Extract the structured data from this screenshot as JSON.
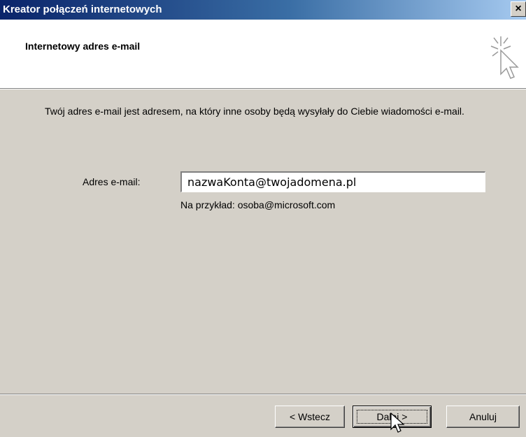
{
  "window": {
    "title": "Kreator połączeń internetowych",
    "close_label": "×"
  },
  "header": {
    "title": "Internetowy adres e-mail",
    "icon": "wizard-cursor-icon"
  },
  "main": {
    "description": "Twój adres e-mail jest adresem, na który inne osoby będą wysyłały do Ciebie wiadomości e-mail.",
    "email_label": "Adres e-mail:",
    "email_value": "nazwaKonta@twojadomena.pl",
    "example": "Na przykład: osoba@microsoft.com"
  },
  "buttons": {
    "back": "< Wstecz",
    "next": "Dalej >",
    "cancel": "Anuluj"
  }
}
